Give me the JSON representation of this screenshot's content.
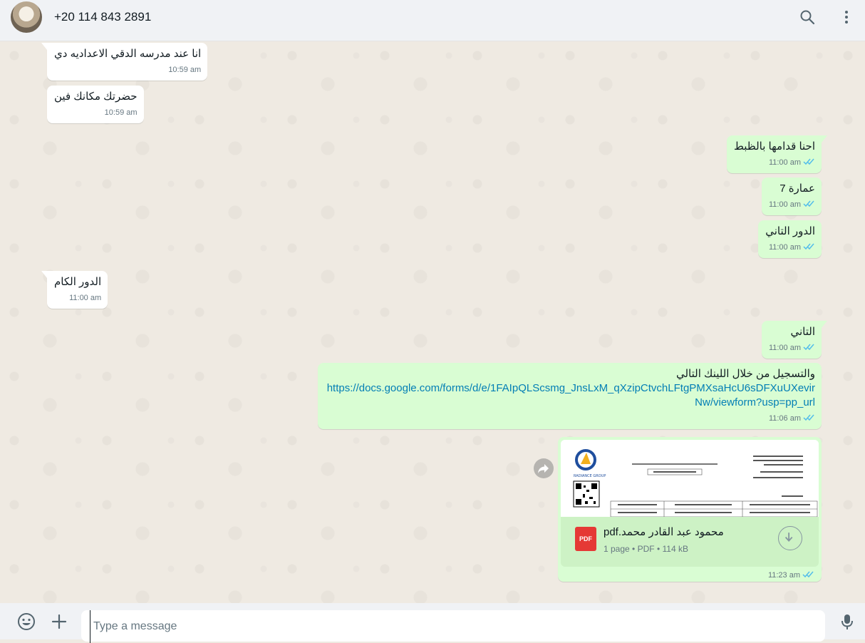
{
  "header": {
    "contact_name": "+20 114 843 2891",
    "avatar_icon": "contact-avatar",
    "search_icon": "search-icon",
    "menu_icon": "more-vertical-icon"
  },
  "messages": [
    {
      "dir": "in",
      "text": "انا عند مدرسه الدقي الاعداديه دي",
      "time": "10:59 am"
    },
    {
      "dir": "in",
      "text": "حضرتك مكانك فين",
      "time": "10:59 am"
    },
    {
      "dir": "out",
      "text": "احنا قدامها بالظبط",
      "time": "11:00 am"
    },
    {
      "dir": "out",
      "text": "عمارة 7",
      "time": "11:00 am"
    },
    {
      "dir": "out",
      "text": "الدور التاني",
      "time": "11:00 am"
    },
    {
      "dir": "in",
      "text": "الدور الكام",
      "time": "11:00 am"
    },
    {
      "dir": "out",
      "text": "التاني",
      "time": "11:00 am"
    },
    {
      "dir": "out",
      "text": "والتسجيل من خلال اللينك التالي",
      "link": "https://docs.google.com/forms/d/e/1FAIpQLScsmg_JnsLxM_qXzipCtvchLFtgPMXsaHcU6sDFXuUXevirNw/viewform?usp=pp_url",
      "time": "11:06 am"
    }
  ],
  "document": {
    "file_name": "محمود عبد القادر محمد.pdf",
    "pages": "1 page",
    "type": "PDF",
    "size": "114 kB",
    "badge": "PDF",
    "time": "11:23 am",
    "preview_logo_text": "RADIANCE GROUP"
  },
  "composer": {
    "placeholder": "Type a message",
    "emoji_icon": "emoji-icon",
    "attach_icon": "plus-icon",
    "mic_icon": "microphone-icon"
  },
  "colors": {
    "incoming": "#ffffff",
    "outgoing": "#d9fdd3",
    "read_ticks": "#53bdeb",
    "link": "#027eb5"
  }
}
